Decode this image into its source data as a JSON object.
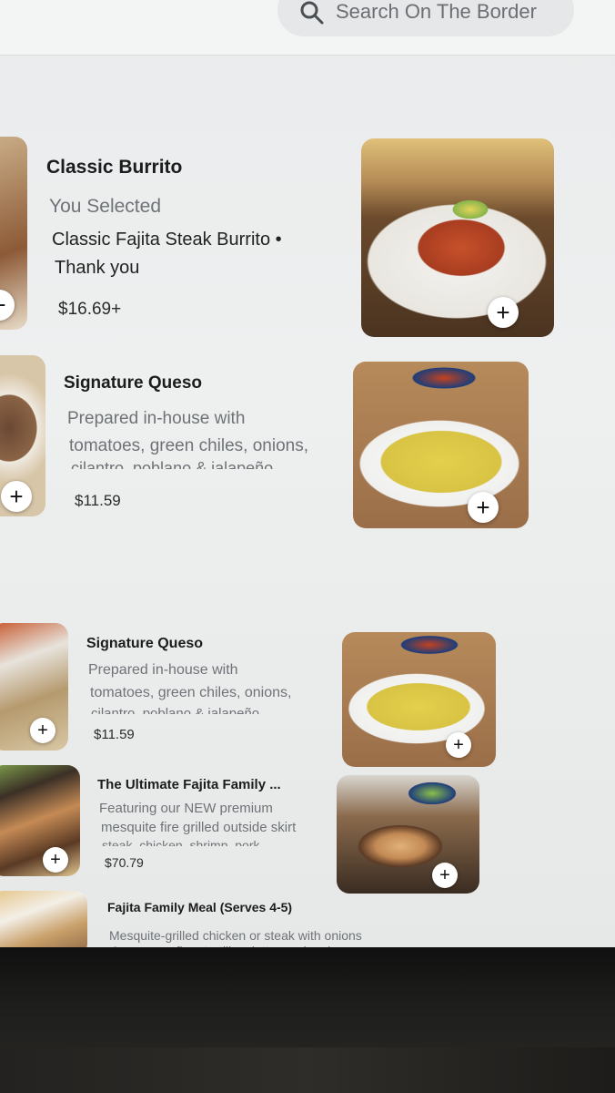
{
  "search": {
    "placeholder": "Search On The Border"
  },
  "items": [
    {
      "title": "Classic Burrito",
      "selected_label": "You Selected",
      "selected_value": "Classic Fajita Steak Burrito •",
      "selected_note": "Thank you",
      "price": "$16.69+"
    },
    {
      "title": "Signature Queso",
      "desc_1": "Prepared in-house with",
      "desc_2": "tomatoes, green chiles, onions,",
      "desc_3": "cilantro, poblano & jalapeño",
      "price": "$11.59"
    },
    {
      "title": "Signature Queso",
      "desc_1": "Prepared in-house with",
      "desc_2": "tomatoes, green chiles, onions,",
      "desc_3": "cilantro, poblano & jalapeño",
      "price": "$11.59"
    },
    {
      "title": "The Ultimate Fajita Family ...",
      "desc_1": "Featuring our NEW premium",
      "desc_2": "mesquite fire grilled outside skirt",
      "desc_3": "steak, chicken, shrimp, pork",
      "price": "$70.79"
    },
    {
      "title": "Fajita Family Meal (Serves 4-5)",
      "desc_1": "Mesquite-grilled chicken or steak with onions",
      "desc_2": "& peppers, flour tortillas, lettuce, pico de"
    }
  ],
  "add_symbol": "+",
  "colors": {
    "accent": "#1c1c1c",
    "muted": "#6f7377",
    "background": "#eef0f0"
  }
}
